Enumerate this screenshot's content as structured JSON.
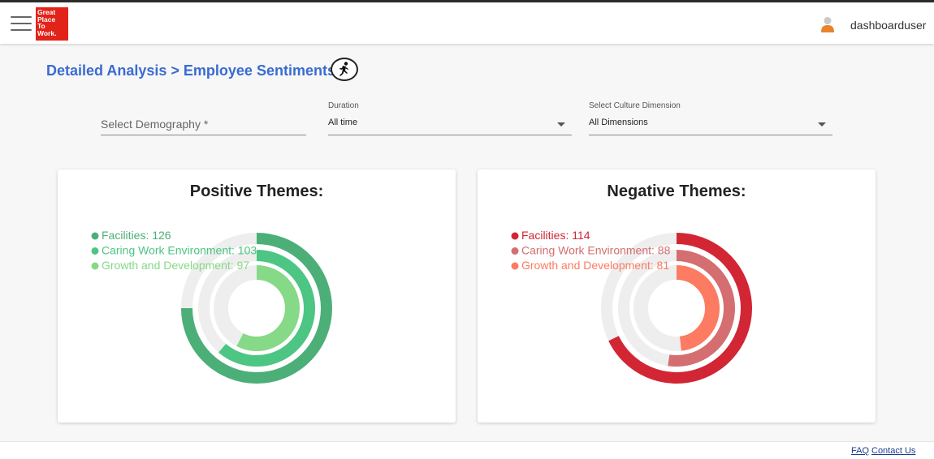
{
  "header": {
    "logo_lines": [
      "Great",
      "Place",
      "To",
      "Work."
    ],
    "username": "dashboarduser"
  },
  "page": {
    "breadcrumb": "Detailed Analysis > Employee Sentiments"
  },
  "filters": {
    "demography": {
      "placeholder": "Select Demography *"
    },
    "duration": {
      "label": "Duration",
      "value": "All time"
    },
    "culture": {
      "label": "Select Culture Dimension",
      "value": "All Dimensions"
    }
  },
  "positive": {
    "title": "Positive Themes:",
    "items": [
      {
        "label": "Facilities: 126",
        "value": 126,
        "color": "#4caf78"
      },
      {
        "label": "Caring Work Environment: 103",
        "value": 103,
        "color": "#4dc583"
      },
      {
        "label": "Growth and Development: 97",
        "value": 97,
        "color": "#86d986"
      }
    ]
  },
  "negative": {
    "title": "Negative Themes:",
    "items": [
      {
        "label": "Facilities: 114",
        "value": 114,
        "color": "#d22634"
      },
      {
        "label": "Caring Work Environment: 88",
        "value": 88,
        "color": "#d46e70"
      },
      {
        "label": "Growth and Development: 81",
        "value": 81,
        "color": "#fc7b62"
      }
    ]
  },
  "footer": {
    "faq": "FAQ",
    "contact": "Contact Us"
  }
}
